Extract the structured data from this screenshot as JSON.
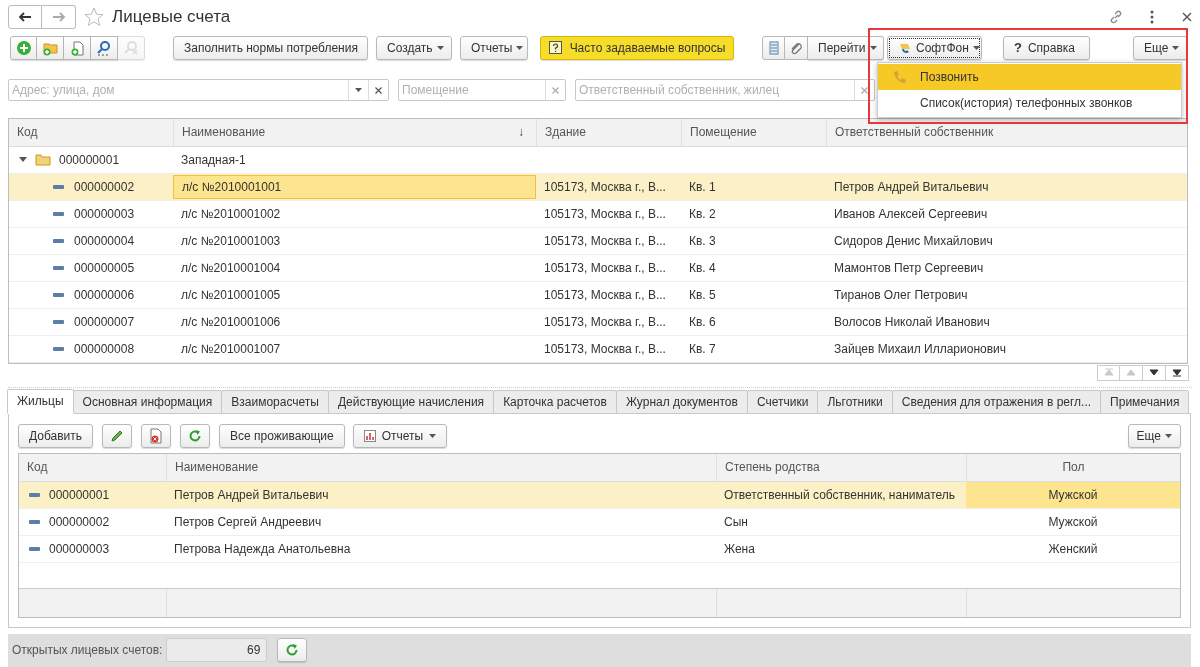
{
  "window": {
    "title": "Лицевые счета",
    "favorite": false
  },
  "toolbar": {
    "icon_buttons": [
      {
        "kind": "add",
        "disabled": false
      },
      {
        "kind": "add-folder",
        "disabled": false
      },
      {
        "kind": "copy",
        "disabled": false
      },
      {
        "kind": "find",
        "disabled": false
      },
      {
        "kind": "cancel-find",
        "disabled": true
      }
    ],
    "buttons": [
      {
        "label": "Заполнить нормы потребления",
        "kind": "plain"
      },
      {
        "label": "Создать",
        "kind": "menu"
      },
      {
        "label": "Отчеты",
        "kind": "menu"
      },
      {
        "label": "Часто задаваемые вопросы",
        "kind": "faq"
      }
    ],
    "right_icons": [
      {
        "kind": "list"
      },
      {
        "kind": "attach"
      }
    ],
    "right_buttons": [
      {
        "label": "Перейти",
        "kind": "menu",
        "focused": false
      },
      {
        "label": "СофтФон",
        "kind": "phone-menu",
        "focused": true
      },
      {
        "label": "Справка",
        "kind": "help",
        "icon": "?",
        "focused": false
      },
      {
        "label": "Еще",
        "kind": "menu",
        "focused": false
      }
    ]
  },
  "softphone_menu": {
    "items": [
      {
        "label": "Позвонить",
        "selected": true
      },
      {
        "label": "Список(история) телефонных звонков",
        "selected": false
      }
    ]
  },
  "filters": [
    {
      "placeholder": "Адрес: улица, дом",
      "dropdown": true
    },
    {
      "placeholder": "Помещение",
      "dropdown": false
    },
    {
      "placeholder": "Ответственный собственник, жилец",
      "dropdown": false
    }
  ],
  "accounts_table": {
    "columns": [
      {
        "label": "Код"
      },
      {
        "label": "Наименование",
        "sort": "↓"
      },
      {
        "label": "Здание"
      },
      {
        "label": "Помещение"
      },
      {
        "label": "Ответственный собственник"
      }
    ],
    "rows": [
      {
        "code": "000000001",
        "name": "Западная-1",
        "expanded": true,
        "children": [
          {
            "code": "000000002",
            "name": "л/с №2010001001",
            "building": "105173, Москва г., В...",
            "room": "Кв. 1",
            "owner": "Петров Андрей Витальевич",
            "selected": true
          },
          {
            "code": "000000003",
            "name": "л/с №2010001002",
            "building": "105173, Москва г., В...",
            "room": "Кв. 2",
            "owner": "Иванов Алексей Сергеевич",
            "selected": false
          },
          {
            "code": "000000004",
            "name": "л/с №2010001003",
            "building": "105173, Москва г., В...",
            "room": "Кв. 3",
            "owner": "Сидоров Денис Михайлович",
            "selected": false
          },
          {
            "code": "000000005",
            "name": "л/с №2010001004",
            "building": "105173, Москва г., В...",
            "room": "Кв. 4",
            "owner": "Мамонтов Петр Сергеевич",
            "selected": false
          },
          {
            "code": "000000006",
            "name": "л/с №2010001005",
            "building": "105173, Москва г., В...",
            "room": "Кв. 5",
            "owner": "Тиранов Олег Петрович",
            "selected": false
          },
          {
            "code": "000000007",
            "name": "л/с №2010001006",
            "building": "105173, Москва г., В...",
            "room": "Кв. 6",
            "owner": "Волосов Николай Иванович",
            "selected": false
          },
          {
            "code": "000000008",
            "name": "л/с №2010001007",
            "building": "105173, Москва г., В...",
            "room": "Кв. 7",
            "owner": "Зайцев Михаил Илларионович",
            "selected": false
          }
        ]
      }
    ]
  },
  "pager": [
    {
      "kind": "first",
      "disabled": true
    },
    {
      "kind": "up",
      "disabled": true
    },
    {
      "kind": "down",
      "disabled": false
    },
    {
      "kind": "last",
      "disabled": false
    }
  ],
  "tabs": [
    {
      "label": "Жильцы",
      "selected": true
    },
    {
      "label": "Основная информация",
      "selected": false
    },
    {
      "label": "Взаиморасчеты",
      "selected": false
    },
    {
      "label": "Действующие начисления",
      "selected": false
    },
    {
      "label": "Карточка расчетов",
      "selected": false
    },
    {
      "label": "Журнал документов",
      "selected": false
    },
    {
      "label": "Счетчики",
      "selected": false
    },
    {
      "label": "Льготники",
      "selected": false
    },
    {
      "label": "Сведения для отражения в регл...",
      "selected": false
    },
    {
      "label": "Примечания",
      "selected": false
    }
  ],
  "residents_toolbar": [
    {
      "kind": "text",
      "label": "Добавить"
    },
    {
      "kind": "edit"
    },
    {
      "kind": "delete"
    },
    {
      "kind": "refresh"
    },
    {
      "kind": "text",
      "label": "Все проживающие"
    },
    {
      "kind": "reports",
      "label": "Отчеты"
    },
    {
      "kind": "more",
      "label": "Еще"
    }
  ],
  "residents_table": {
    "columns": [
      {
        "label": "Код"
      },
      {
        "label": "Наименование"
      },
      {
        "label": "Степень родства"
      },
      {
        "label": "Пол"
      }
    ],
    "rows": [
      {
        "code": "000000001",
        "name": "Петров Андрей Витальевич",
        "relation": "Ответственный собственник, наниматель",
        "sex": "Мужской",
        "selected": true
      },
      {
        "code": "000000002",
        "name": "Петров Сергей Андреевич",
        "relation": "Сын",
        "sex": "Мужской",
        "selected": false
      },
      {
        "code": "000000003",
        "name": "Петрова Надежда Анатольевна",
        "relation": "Жена",
        "sex": "Женский",
        "selected": false
      }
    ]
  },
  "footer": {
    "label": "Открытых лицевых счетов:",
    "value": "69"
  }
}
